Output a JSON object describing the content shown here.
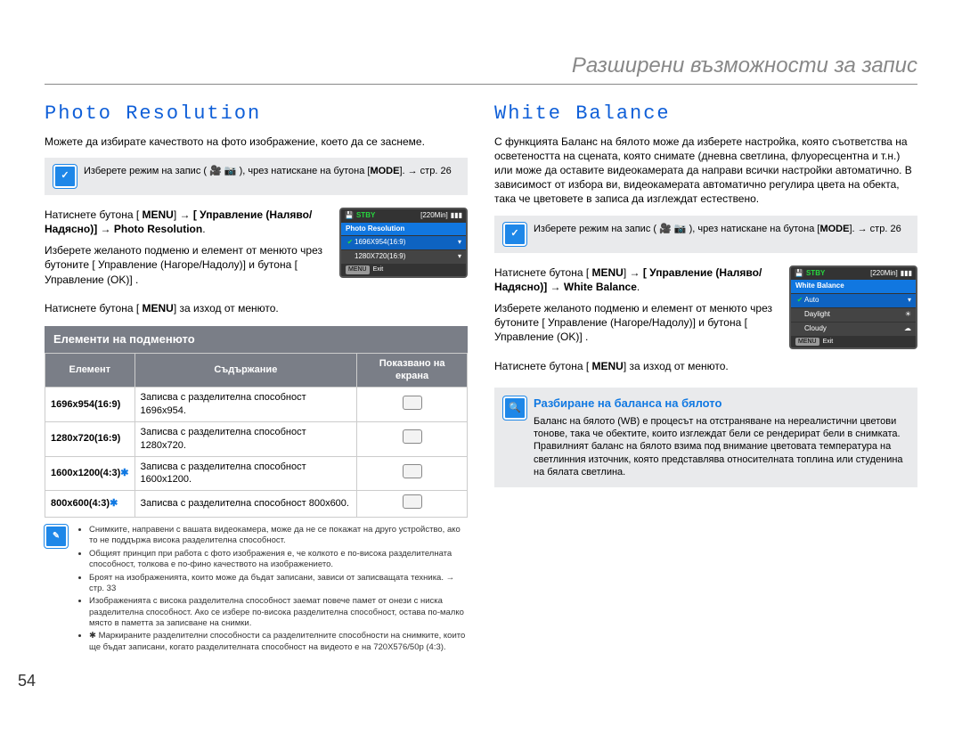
{
  "chapter": "Разширени възможности за запис",
  "page_number": "54",
  "left": {
    "heading": "Photo Resolution",
    "intro": "Можете да избирате качеството на фото изображение, което да се заснеме.",
    "note_pre": "Изберете режим на запис ( ",
    "note_post": " ), чрез натискане на бутона [",
    "note_mode": "MODE",
    "note_ref": "]. → стр. 26",
    "step1a": "Натиснете бутона [ ",
    "step1b": " → [ Управление (Наляво/Надясно)] → Photo Resolution",
    "menu_word": "MENU",
    "step2": "Изберете желаното подменю и елемент от менюто чрез бутоните [ Управление (Нагоре/Надолу)] и бутона [ Управление (OK)] .",
    "step3a": "Натиснете бутона [ ",
    "step3b": "] за изход от менюто.",
    "subhead": "Елементи на подменюто",
    "table_headers": {
      "c1": "Елемент",
      "c2": "Съдържание",
      "c3": "Показвано на екрана"
    },
    "rows": [
      {
        "name": "1696x954(16:9)",
        "star": false,
        "desc": "Записва с разделителна способност 1696x954."
      },
      {
        "name": "1280x720(16:9)",
        "star": false,
        "desc": "Записва с разделителна способност 1280x720."
      },
      {
        "name": "1600x1200(4:3)",
        "star": true,
        "desc": "Записва с разделителна способност 1600x1200."
      },
      {
        "name": "800x600(4:3)",
        "star": true,
        "desc": "Записва с разделителна способност 800x600."
      }
    ],
    "foot": [
      "Снимките, направени с вашата видеокамера, може да не се покажат на друго устройство, ако то не поддържа висока разделителна способност.",
      "Общият принцип при работа с фото изображения е, че колкото е по-висока разделителната способност, толкова е по-фино качеството на изображението.",
      "Броят на изображенията, които може да бъдат записани, зависи от записващата техника. → стр. 33",
      "Изображенията с висока разделителна способност заемат повече памет от онези с ниска разделителна способност. Ако се избере по-висока разделителна способност, остава по-малко място в паметта за записване на снимки.",
      "✱ Маркираните разделителни способности са разделителните способности на снимките, които ще бъдат записани, когато разделителната способност на видеото е на 720X576/50p (4:3)."
    ],
    "lcd": {
      "stby": "STBY",
      "time": "[220Min]",
      "title": "Photo Resolution",
      "row1": "1696X954(16:9)",
      "row2": "1280X720(16:9)",
      "exit": "Exit"
    }
  },
  "right": {
    "heading": "White Balance",
    "intro": "С функцията Баланс на бялото може да изберете настройка, която съответства на осветеността на сцената, която снимате (дневна светлина, флуоресцентна и т.н.) или може да оставите видеокамерата да направи всички настройки автоматично. В зависимост от избора ви, видеокамерата автоматично регулира цвета на обекта, така че цветовете в записа да изглеждат естествено.",
    "note_pre": "Изберете режим на запис ( ",
    "note_post": " ), чрез натискане на бутона [",
    "note_mode": "MODE",
    "note_ref": "]. → стр. 26",
    "step1b": " → [ Управление (Наляво/Надясно)] → White Balance",
    "step2": "Изберете желаното подменю и елемент от менюто чрез бутоните [ Управление (Нагоре/Надолу)] и бутона [ Управление (OK)] .",
    "step3a": "Натиснете бутона [ ",
    "step3b": "] за изход от менюто.",
    "info_title": "Разбиране на баланса на бялото",
    "info_body": "Баланс на бялото (WB) е процесът на отстраняване на нереалистични цветови тонове, така че обектите, които изглеждат бели се рендерират бели в снимката. Правилният баланс на бялото взима под внимание цветовата температура на светлинния източник, която представлява относителната топлина или студенина на бялата светлина.",
    "lcd": {
      "stby": "STBY",
      "time": "[220Min]",
      "title": "White Balance",
      "row1": "Auto",
      "row2": "Daylight",
      "row3": "Cloudy",
      "exit": "Exit"
    }
  }
}
